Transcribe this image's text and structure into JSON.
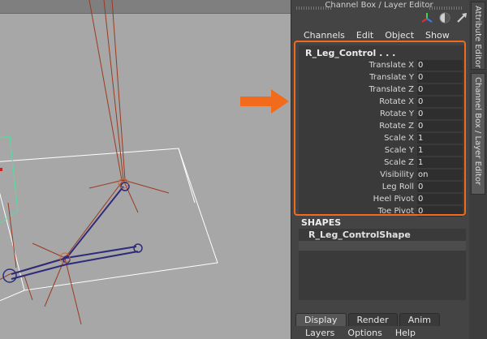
{
  "panel": {
    "title": "Channel Box / Layer Editor",
    "menus": [
      "Channels",
      "Edit",
      "Object",
      "Show"
    ],
    "side_tabs": [
      "Attribute Editor",
      "Channel Box / Layer Editor"
    ]
  },
  "channel_box": {
    "node_name": "R_Leg_Control . . .",
    "attributes": [
      {
        "label": "Translate X",
        "value": "0"
      },
      {
        "label": "Translate Y",
        "value": "0"
      },
      {
        "label": "Translate Z",
        "value": "0"
      },
      {
        "label": "Rotate X",
        "value": "0"
      },
      {
        "label": "Rotate Y",
        "value": "0"
      },
      {
        "label": "Rotate Z",
        "value": "0"
      },
      {
        "label": "Scale X",
        "value": "1"
      },
      {
        "label": "Scale Y",
        "value": "1"
      },
      {
        "label": "Scale Z",
        "value": "1"
      },
      {
        "label": "Visibility",
        "value": "on"
      },
      {
        "label": "Leg Roll",
        "value": "0"
      },
      {
        "label": "Heel Pivot",
        "value": "0"
      },
      {
        "label": "Toe Pivot",
        "value": "0"
      }
    ]
  },
  "shapes": {
    "heading": "SHAPES",
    "items": [
      "R_Leg_ControlShape"
    ]
  },
  "layer_editor": {
    "tabs": [
      "Display",
      "Render",
      "Anim"
    ],
    "menus": [
      "Layers",
      "Options",
      "Help"
    ]
  },
  "icons": [
    "axis-gizmo-icon",
    "sphere-shading-icon",
    "pick-arrow-icon"
  ],
  "colors": {
    "highlight": "#f26a1b",
    "arrow": "#f26a1b"
  }
}
